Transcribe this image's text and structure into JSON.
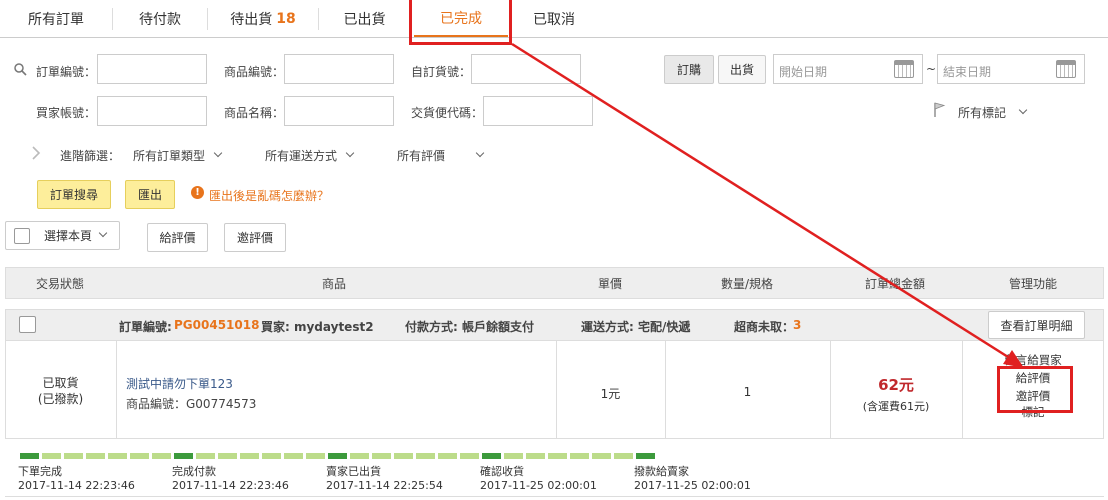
{
  "tabs": [
    {
      "label": "所有訂單",
      "count": ""
    },
    {
      "label": "待付款",
      "count": ""
    },
    {
      "label": "待出貨",
      "count": "18"
    },
    {
      "label": "已出貨",
      "count": ""
    },
    {
      "label": "已完成",
      "count": ""
    },
    {
      "label": "已取消",
      "count": ""
    }
  ],
  "filters": {
    "order_no": "訂單編號：",
    "product_no": "商品編號：",
    "custom_no": "自訂貨號：",
    "buyer_account": "買家帳號：",
    "product_name": "商品名稱：",
    "delivery_code": "交貨便代碼：",
    "date_order_btn": "訂購",
    "date_ship_btn": "出貨",
    "start_date_placeholder": "開始日期",
    "tilde": "~",
    "end_date_placeholder": "結束日期",
    "all_flags": "所有標記",
    "advanced": "進階篩選：",
    "order_type": "所有訂單類型",
    "shipping": "所有運送方式",
    "rating": "所有評價"
  },
  "actions": {
    "search": "訂單搜尋",
    "export": "匯出",
    "help": "匯出後是亂碼怎麼辦？",
    "select_page": "選擇本頁",
    "give_rating": "給評價",
    "invite_rating": "邀評價"
  },
  "table": {
    "headers": [
      "交易狀態",
      "商品",
      "單價",
      "數量/規格",
      "訂單總金額",
      "管理功能"
    ],
    "order": {
      "order_no_label": "訂單編號:",
      "order_no": "PG00451018",
      "buyer": "買家: mydaytest2",
      "payment": "付款方式: 帳戶餘額支付",
      "shipping": "運送方式: 宅配/快遞",
      "uncollected_label": "超商未取：",
      "uncollected": "3",
      "detail_btn": "查看訂單明細"
    },
    "item": {
      "status_line1": "已取貨",
      "status_line2": "(已撥款)",
      "product_name": "測試中請勿下單123",
      "product_no": "商品編號：G00774573",
      "price": "1元",
      "qty": "1",
      "total": "62元",
      "total_note": "(含運費61元)",
      "manage": [
        "留言給買家",
        "給評價",
        "邀評價",
        "標記"
      ]
    }
  },
  "progress": {
    "steps": [
      {
        "label": "下單完成",
        "time": "2017-11-14 22:23:46"
      },
      {
        "label": "完成付款",
        "time": "2017-11-14 22:23:46"
      },
      {
        "label": "賣家已出貨",
        "time": "2017-11-14 22:25:54"
      },
      {
        "label": "確認收貨",
        "time": "2017-11-25 02:00:01"
      },
      {
        "label": "撥款給賣家",
        "time": "2017-11-25 02:00:01"
      }
    ]
  },
  "colors": {
    "accent": "#e8741c",
    "annotation": "#e02020",
    "price": "#c0282c",
    "progress_dark": "#3c9a3c",
    "progress_light": "#bcdc8a",
    "link": "#3a5a8a"
  }
}
